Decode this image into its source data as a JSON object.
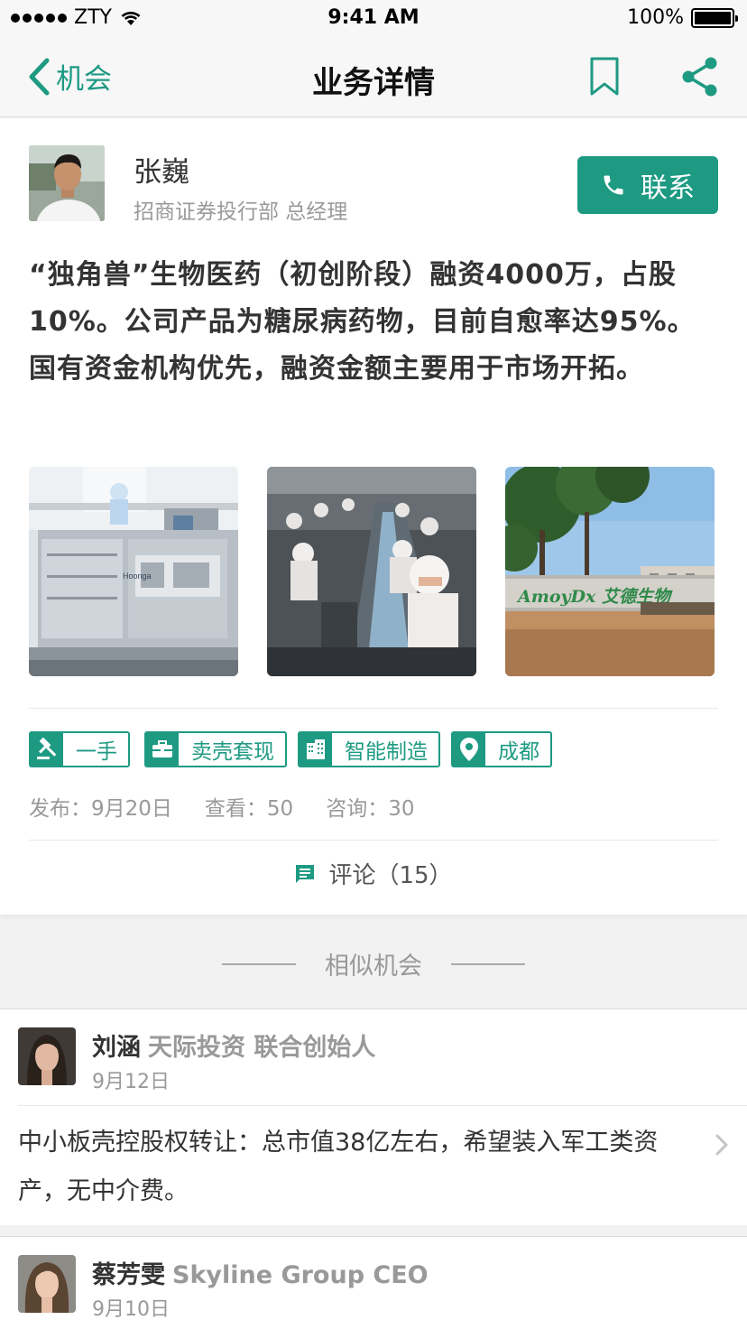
{
  "status_bar": {
    "carrier": "ZTY",
    "time": "9:41 AM",
    "battery": "100%",
    "battery_level": 1.0
  },
  "nav": {
    "back_label": "机会",
    "title": "业务详情",
    "icons": [
      "chevron-left-icon",
      "bookmark-icon",
      "share-icon"
    ]
  },
  "author": {
    "name": "张巍",
    "title": "招商证券投行部 总经理",
    "contact_label": "联系"
  },
  "description": "“独角兽”生物医药（初创阶段）融资4000万，占股10%。公司产品为糖尿病药物，目前自愈率达95%。国有资金机构优先，融资金额主要用于市场开拓。",
  "photos": [
    {
      "label": "Hoonga"
    },
    {
      "label": ""
    },
    {
      "label": "AmoyDx 艾德生物"
    }
  ],
  "tags": [
    {
      "label": "一手",
      "icon": "gavel-icon"
    },
    {
      "label": "卖壳套现",
      "icon": "briefcase-icon"
    },
    {
      "label": "智能制造",
      "icon": "building-icon"
    },
    {
      "label": "成都",
      "icon": "location-pin-icon"
    }
  ],
  "stats": {
    "publish": "发布：9月20日",
    "views": "查看：50",
    "inquiries": "咨询：30"
  },
  "comments_label": "评论（15）",
  "similar_header": "相似机会",
  "similar": [
    {
      "name": "刘涵",
      "org": "天际投资 联合创始人",
      "date": "9月12日",
      "desc": "中小板壳控股权转让：总市值38亿左右，希望装入军工类资产，无中介费。"
    },
    {
      "name": "蔡芳雯",
      "org": "Skyline Group CEO",
      "date": "9月10日"
    }
  ],
  "colors": {
    "accent": "#1e9a83",
    "text": "#333333",
    "muted": "#999999",
    "background": "#f2f2f2"
  }
}
